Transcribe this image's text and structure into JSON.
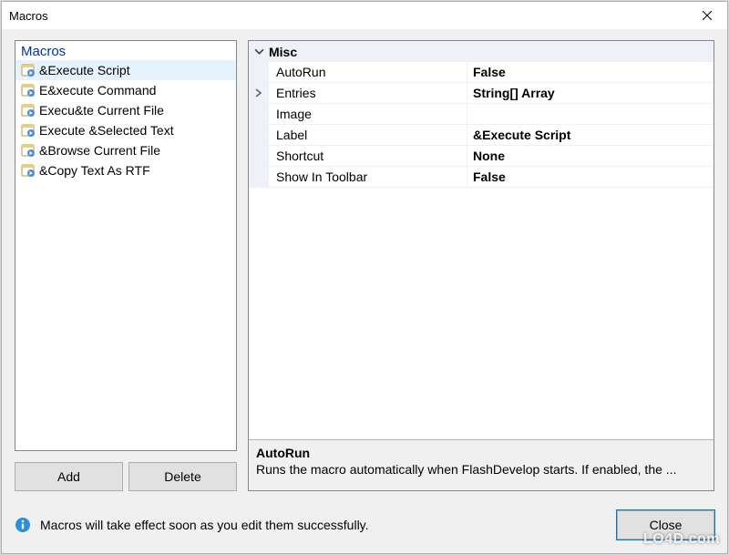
{
  "window": {
    "title": "Macros"
  },
  "list": {
    "header": "Macros",
    "items": [
      {
        "label": "&Execute Script",
        "selected": true
      },
      {
        "label": "E&xecute Command",
        "selected": false
      },
      {
        "label": "Execu&te Current File",
        "selected": false
      },
      {
        "label": "Execute &Selected Text",
        "selected": false
      },
      {
        "label": "&Browse Current File",
        "selected": false
      },
      {
        "label": "&Copy Text As RTF",
        "selected": false
      }
    ]
  },
  "buttons": {
    "add": "Add",
    "delete": "Delete",
    "close": "Close"
  },
  "propgrid": {
    "category": "Misc",
    "rows": [
      {
        "name": "AutoRun",
        "value": "False",
        "selected": false
      },
      {
        "name": "Entries",
        "value": "String[] Array",
        "selected": true
      },
      {
        "name": "Image",
        "value": "",
        "selected": false
      },
      {
        "name": "Label",
        "value": "&Execute Script",
        "selected": false
      },
      {
        "name": "Shortcut",
        "value": "None",
        "selected": false
      },
      {
        "name": "Show In Toolbar",
        "value": "False",
        "selected": false
      }
    ],
    "help": {
      "title": "AutoRun",
      "text": "Runs the macro automatically when FlashDevelop starts. If enabled, the ..."
    }
  },
  "footer": {
    "message": "Macros will take effect soon as you edit them successfully."
  },
  "watermark": "LO4D.com"
}
